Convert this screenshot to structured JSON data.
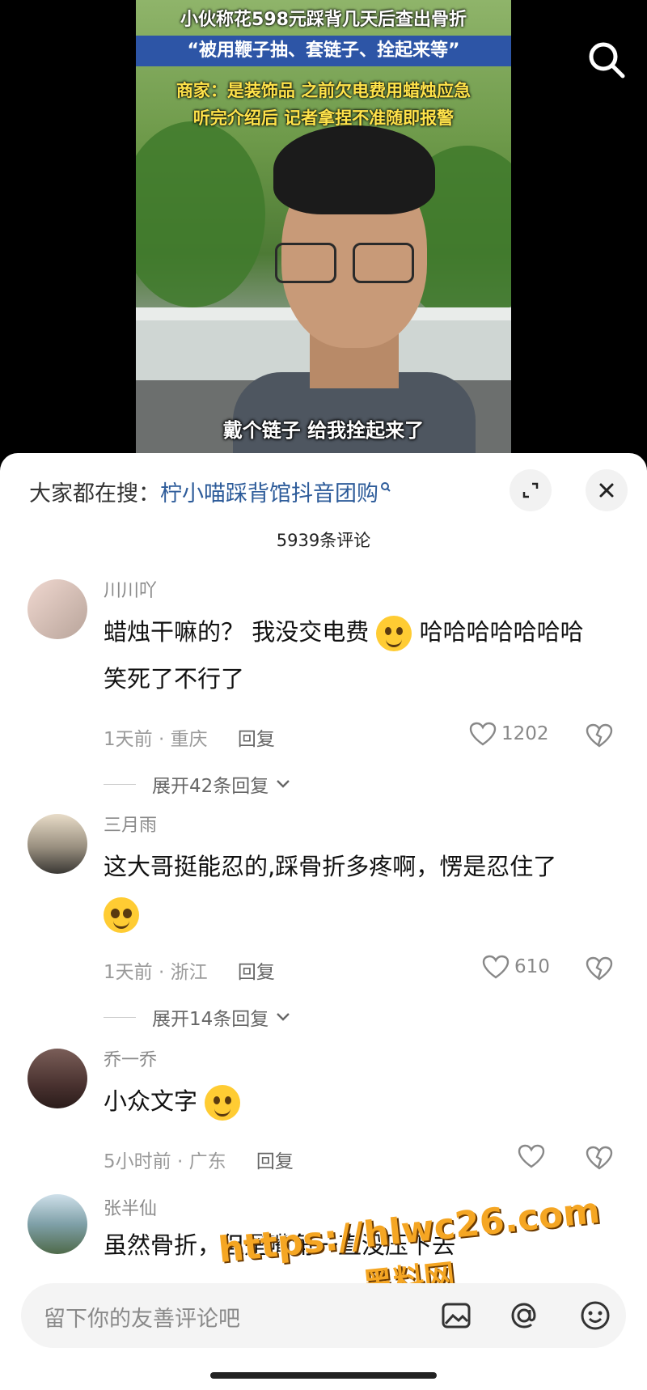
{
  "video": {
    "caption_lines": [
      "小伙称花598元踩背几天后查出骨折",
      "“被用鞭子抽、套链子、拴起来等”",
      "商家：是装饰品 之前欠电费用蜡烛应急",
      "听完介绍后 记者拿捏不准随即报警"
    ],
    "subtitle": "戴个链子 给我拴起来了",
    "search_icon": "search-icon"
  },
  "comments_panel": {
    "hot_search_label": "大家都在搜：",
    "hot_search_term": "柠小喵踩背馆抖音团购",
    "count_label": "5939条评论",
    "comments": [
      {
        "username": "川川吖",
        "text_before_emoji": "蜡烛干嘛的？ 我没交电费",
        "text_after_emoji": "哈哈哈哈哈哈哈",
        "text_line2": "笑死了不行了",
        "time": "1天前",
        "location": "重庆",
        "reply_label": "回复",
        "likes": "1202",
        "expand_label": "展开42条回复"
      },
      {
        "username": "三月雨",
        "text_line1": "这大哥挺能忍的,踩骨折多疼啊，愣是忍住了",
        "time": "1天前",
        "location": "浙江",
        "reply_label": "回复",
        "likes": "610",
        "expand_label": "展开14条回复"
      },
      {
        "username": "乔一乔",
        "text_line1": "小众文字",
        "time": "5小时前",
        "location": "广东",
        "reply_label": "回复",
        "likes": ""
      },
      {
        "username": "张半仙",
        "text_line1": "虽然骨折，但是嘴角一直没压下去"
      }
    ]
  },
  "input_bar": {
    "placeholder": "留下你的友善评论吧"
  },
  "watermark": {
    "line1": "https://hlwc26.com",
    "line2": "黑料网"
  },
  "colors": {
    "link": "#2e5c9a",
    "caption_blue": "#2d55a6",
    "caption_yellow": "#ffe34a"
  }
}
